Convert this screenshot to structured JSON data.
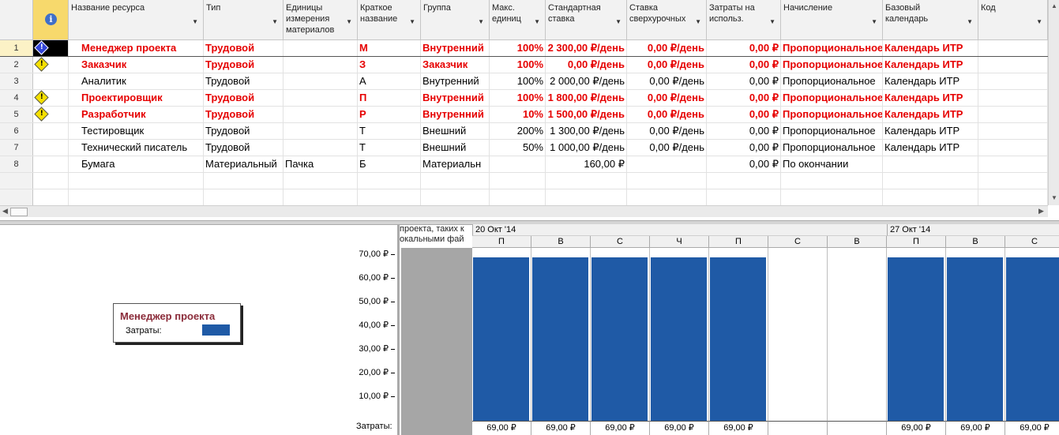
{
  "sheet": {
    "info_icon": "info-icon",
    "columns": [
      {
        "key": "name",
        "label": "Название ресурса"
      },
      {
        "key": "type",
        "label": "Тип"
      },
      {
        "key": "units",
        "label": "Единицы измерения материалов"
      },
      {
        "key": "short",
        "label": "Краткое название"
      },
      {
        "key": "group",
        "label": "Группа"
      },
      {
        "key": "max",
        "label": "Макс. единиц"
      },
      {
        "key": "std",
        "label": "Стандартная ставка"
      },
      {
        "key": "ovt",
        "label": "Ставка сверхурочных"
      },
      {
        "key": "cost",
        "label": "Затраты на использ."
      },
      {
        "key": "accrue",
        "label": "Начисление"
      },
      {
        "key": "cal",
        "label": "Базовый календарь"
      },
      {
        "key": "code",
        "label": "Код"
      }
    ],
    "rows": [
      {
        "n": "1",
        "ind": "warn-blue",
        "over": true,
        "name": "Менеджер проекта",
        "type": "Трудовой",
        "units": "",
        "short": "М",
        "group": "Внутренний",
        "max": "100%",
        "std": "2 300,00 ₽/день",
        "ovt": "0,00 ₽/день",
        "cost": "0,00 ₽",
        "accrue": "Пропорциональное",
        "cal": "Календарь ИТР",
        "code": ""
      },
      {
        "n": "2",
        "ind": "warn",
        "over": true,
        "name": "Заказчик",
        "type": "Трудовой",
        "units": "",
        "short": "З",
        "group": "Заказчик",
        "max": "100%",
        "std": "0,00 ₽/день",
        "ovt": "0,00 ₽/день",
        "cost": "0,00 ₽",
        "accrue": "Пропорциональное",
        "cal": "Календарь ИТР",
        "code": ""
      },
      {
        "n": "3",
        "ind": "",
        "over": false,
        "name": "Аналитик",
        "type": "Трудовой",
        "units": "",
        "short": "А",
        "group": "Внутренний",
        "max": "100%",
        "std": "2 000,00 ₽/день",
        "ovt": "0,00 ₽/день",
        "cost": "0,00 ₽",
        "accrue": "Пропорциональное",
        "cal": "Календарь ИТР",
        "code": ""
      },
      {
        "n": "4",
        "ind": "warn",
        "over": true,
        "name": "Проектировщик",
        "type": "Трудовой",
        "units": "",
        "short": "П",
        "group": "Внутренний",
        "max": "100%",
        "std": "1 800,00 ₽/день",
        "ovt": "0,00 ₽/день",
        "cost": "0,00 ₽",
        "accrue": "Пропорциональное",
        "cal": "Календарь ИТР",
        "code": ""
      },
      {
        "n": "5",
        "ind": "warn",
        "over": true,
        "name": "Разработчик",
        "type": "Трудовой",
        "units": "",
        "short": "Р",
        "group": "Внутренний",
        "max": "10%",
        "std": "1 500,00 ₽/день",
        "ovt": "0,00 ₽/день",
        "cost": "0,00 ₽",
        "accrue": "Пропорциональное",
        "cal": "Календарь ИТР",
        "code": ""
      },
      {
        "n": "6",
        "ind": "",
        "over": false,
        "name": "Тестировщик",
        "type": "Трудовой",
        "units": "",
        "short": "Т",
        "group": "Внешний",
        "max": "200%",
        "std": "1 300,00 ₽/день",
        "ovt": "0,00 ₽/день",
        "cost": "0,00 ₽",
        "accrue": "Пропорциональное",
        "cal": "Календарь ИТР",
        "code": ""
      },
      {
        "n": "7",
        "ind": "",
        "over": false,
        "name": "Технический писатель",
        "type": "Трудовой",
        "units": "",
        "short": "Т",
        "group": "Внешний",
        "max": "50%",
        "std": "1 000,00 ₽/день",
        "ovt": "0,00 ₽/день",
        "cost": "0,00 ₽",
        "accrue": "Пропорциональное",
        "cal": "Календарь ИТР",
        "code": ""
      },
      {
        "n": "8",
        "ind": "",
        "over": false,
        "name": "Бумага",
        "type": "Материальный",
        "units": "Пачка",
        "short": "Б",
        "group": "Материальн",
        "max": "",
        "std": "160,00 ₽",
        "ovt": "",
        "cost": "0,00 ₽",
        "accrue": "По окончании",
        "cal": "",
        "code": ""
      },
      {
        "n": "",
        "ind": "",
        "over": false,
        "name": "",
        "type": "",
        "units": "",
        "short": "",
        "group": "",
        "max": "",
        "std": "",
        "ovt": "",
        "cost": "",
        "accrue": "",
        "cal": "",
        "code": ""
      },
      {
        "n": "",
        "ind": "",
        "over": false,
        "name": "",
        "type": "",
        "units": "",
        "short": "",
        "group": "",
        "max": "",
        "std": "",
        "ovt": "",
        "cost": "",
        "accrue": "",
        "cal": "",
        "code": ""
      }
    ]
  },
  "graph": {
    "legend_title": "Менеджер проекта",
    "legend_label": "Затраты:",
    "note_text": "проекта, таких к окальными фай",
    "totals_label": "Затраты:",
    "colors": {
      "bar": "#1f5aa6",
      "over": "#e60000"
    },
    "weeks": [
      "20 Окт '14",
      "27 Окт '14"
    ],
    "chart_data": {
      "type": "bar",
      "categories": [
        "П",
        "В",
        "С",
        "Ч",
        "П",
        "С",
        "В",
        "П",
        "В",
        "С"
      ],
      "values": [
        69,
        69,
        69,
        69,
        69,
        0,
        0,
        69,
        69,
        69
      ],
      "totals": [
        "69,00 ₽",
        "69,00 ₽",
        "69,00 ₽",
        "69,00 ₽",
        "69,00 ₽",
        "",
        "",
        "69,00 ₽",
        "69,00 ₽",
        "69,00 ₽"
      ],
      "yticks": [
        "10,00 ₽",
        "20,00 ₽",
        "30,00 ₽",
        "40,00 ₽",
        "50,00 ₽",
        "60,00 ₽",
        "70,00 ₽"
      ],
      "ylim": [
        0,
        73
      ],
      "series": [
        {
          "name": "Затраты:",
          "values": [
            69,
            69,
            69,
            69,
            69,
            0,
            0,
            69,
            69,
            69
          ]
        }
      ]
    }
  }
}
